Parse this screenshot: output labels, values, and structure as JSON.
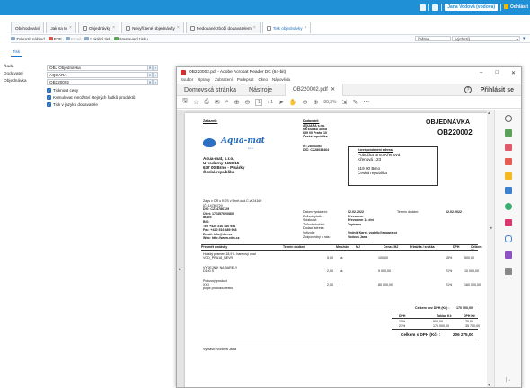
{
  "topbar": {
    "user": "Jana Vodová (vodova)",
    "company": "Odhlásit"
  },
  "tabs": [
    {
      "label": "Obchodování",
      "x": false
    },
    {
      "label": "Jak na to",
      "x": true
    },
    {
      "label": "Objednávky",
      "x": true
    },
    {
      "label": "Nevyřízené objednávky",
      "x": true
    },
    {
      "label": "Nedodané zboží dodavatelem",
      "x": true
    },
    {
      "label": "Tisk objednávky",
      "x": true,
      "active": true
    }
  ],
  "toolbar": {
    "items": [
      "Zobrazit náhled",
      "PDF",
      "Email",
      "Lokální tisk",
      "Nastavení tisku"
    ],
    "select_1": "čeština",
    "select_2": "(výchozí)"
  },
  "subtab": "Tisk",
  "form": {
    "sestava_label": "Řada",
    "sestava_value": "OBJ Objednávka",
    "dodavatel_label": "Dodavatel",
    "dodavatel_value": "AQUARA",
    "objednavka_label": "Objednávka",
    "objednavka_value": "OB220002",
    "checks": [
      "Tisknout ceny",
      "Kumulovat množství stejných řádků produktů",
      "Tisk v jazyku dodavatele"
    ]
  },
  "acrobat": {
    "title": "OB220002.pdf - Adobe Acrobat Reader DC (64-bit)",
    "menu": [
      "Soubor",
      "Úpravy",
      "Zobrazení",
      "Podepsat",
      "Okno",
      "Nápověda"
    ],
    "tab_home": "Domovská stránka",
    "tab_tools": "Nástroje",
    "tab_doc": "OB220002.pdf",
    "signin": "Přihlásit se",
    "page_current": "1",
    "page_total": "/ 1",
    "zoom": "88,3%"
  },
  "doc": {
    "zakaznik_lbl": "Zákazník:",
    "dodavatel_lbl": "Dodavatel:",
    "title": "OBJEDNÁVKA",
    "number": "OB220002",
    "logo": "Aqua-mat",
    "logo_sub": "s.r.o.",
    "supplier": [
      "AQUARA s.r.o.",
      "Na klučku 385/8",
      "639 00 Praha 10",
      "Česká republika"
    ],
    "supplier_ic": "IČ: 28033464",
    "supplier_dic": "DIČ: CZ28033464",
    "customer": [
      "Aqua-mat, s.r.o.",
      "U vodárny 3458/15",
      "637 00 Brno - Písárky",
      "Česká republika"
    ],
    "ship_lbl": "Korespondenční adresa:",
    "ship": [
      "Pobočka Brno Křenová",
      "Křenová 123",
      "",
      "619 00 Brno",
      "Česká republika"
    ],
    "cust_info": [
      "Zaps v OR u KOS v Brně,odd.C,vl.24169",
      "IČ: 14786729",
      "DIČ: CZ14786729",
      "Účet: 17635762/0800",
      "IBAN:",
      "BIC:",
      "Tel: +420 516 480 951",
      "Fax: +420 516 489 968",
      "Email: info@rkn.cz",
      "Web: http://www.rdm.cz"
    ],
    "meta_labels": [
      "Datum vystavení:",
      "Způsob platby:",
      "Splatnost:",
      "Způsob dodání:",
      "Dodací adresa:",
      "Vyřizuje:",
      "Zodpovědný u nás:"
    ],
    "meta_values": [
      "02.02.2022",
      "Převodem",
      "Převodem 14 dní",
      "Toptrans",
      "",
      "Vedník Karel, vodnik@aquara.cz",
      "Vodová Jana"
    ],
    "dodani_lbl": "Termín dodání:",
    "dodani_val": "02.02.2022",
    "cols": [
      "Předmět dodávky",
      "Termín dodání",
      "Množství",
      "MJ",
      "Cena / MJ",
      "Přirážka / sráška",
      "DPH",
      "Celkem Kč"
    ],
    "rows": [
      {
        "name": "Horský pramen 18,9 l - barelový obal",
        "code": "VOD_PRA18_NEVR",
        "qty": "5,00",
        "mj": "ks",
        "price": "100,00",
        "dph": "15%",
        "total": "500,00"
      },
      {
        "name": "VÝDEJNÍK NA BARELY",
        "code": "D100 S",
        "qty": "2,00",
        "mj": "ks",
        "price": "5 000,00",
        "dph": "21%",
        "total": "10 000,00"
      },
      {
        "name": "Pokusný produkt",
        "code": "XXX",
        "code2": "popis produktu textík",
        "qty": "2,00",
        "mj": "l",
        "price": "80 000,00",
        "dph": "21%",
        "total": "160 000,00"
      }
    ],
    "sum_bez_lbl": "Celkem bez DPH (Kč) :",
    "sum_bez": "170 500,00",
    "dph_head": [
      "DPH",
      "Základ Kč",
      "DPH Kč"
    ],
    "dph_rows": [
      [
        "15%",
        "500,00",
        "75,00"
      ],
      [
        "21%",
        "170 000,00",
        "35 700,00"
      ]
    ],
    "sum_s_lbl": "Celkem s DPH (Kč) :",
    "sum_s": "206 275,00",
    "vystavil": "Vystavil: Vodová Jana"
  }
}
